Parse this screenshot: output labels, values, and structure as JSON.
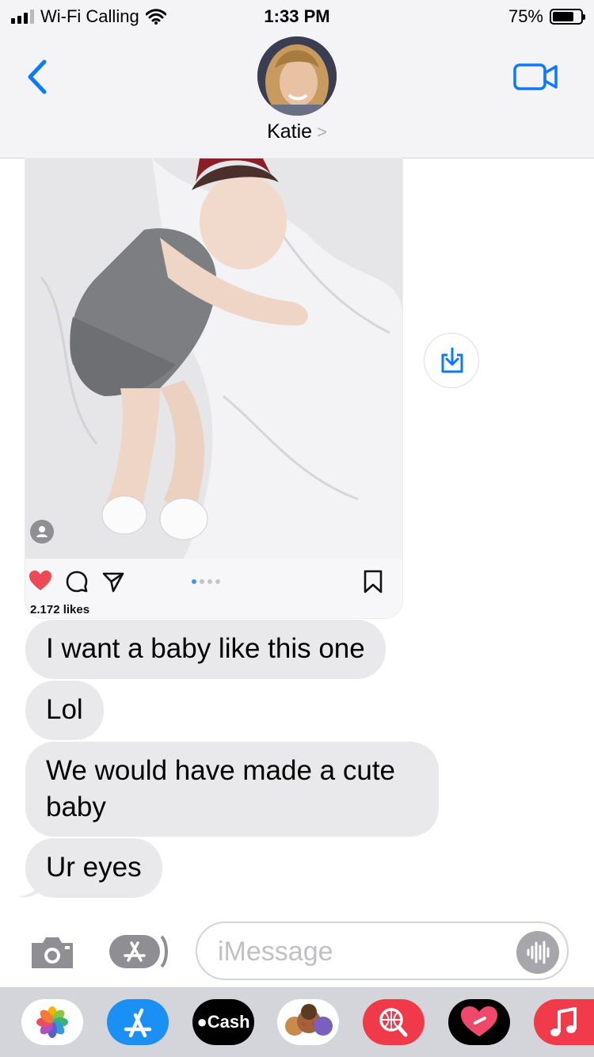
{
  "status_bar": {
    "carrier": "Wi-Fi Calling",
    "time": "1:33 PM",
    "battery_percent": "75%",
    "battery_level": 0.75
  },
  "header": {
    "contact_name": "Katie",
    "contact_chevron": ">",
    "back_icon": "chevron-left-icon",
    "video_icon": "video-camera-icon"
  },
  "instagram_post": {
    "likes": "2.172 likes",
    "carousel_dots": 4,
    "carousel_active": 1,
    "icons": [
      "heart-icon",
      "comment-icon",
      "share-icon",
      "bookmark-icon"
    ],
    "heart_color": "#ed4956",
    "dot_active_color": "#3897f0"
  },
  "save_button_icon": "download-icon",
  "messages": [
    {
      "text": "I want a baby like this one",
      "from": "them"
    },
    {
      "text": "Lol",
      "from": "them"
    },
    {
      "text": "We would have made a cute baby",
      "from": "them"
    },
    {
      "text": "Ur eyes",
      "from": "them"
    }
  ],
  "input_bar": {
    "placeholder": "iMessage",
    "camera_icon": "camera-icon",
    "apps_icon": "app-store-icon",
    "audio_icon": "waveform-icon"
  },
  "app_drawer": {
    "apps": [
      {
        "name": "Photos",
        "icon": "photos-icon"
      },
      {
        "name": "App Store",
        "icon": "app-store-icon"
      },
      {
        "name": "Cash",
        "label": "Cash",
        "icon": "apple-cash-icon"
      },
      {
        "name": "Memoji",
        "icon": "memoji-icon"
      },
      {
        "name": "Search",
        "icon": "web-search-icon"
      },
      {
        "name": "Digital Touch",
        "icon": "digital-touch-icon"
      },
      {
        "name": "Music",
        "icon": "music-icon"
      }
    ]
  },
  "colors": {
    "accent": "#0a7aff",
    "bubble_gray": "#e9e9eb",
    "header_bg": "#f4f4f6",
    "drawer_bg": "#d4d5da"
  }
}
